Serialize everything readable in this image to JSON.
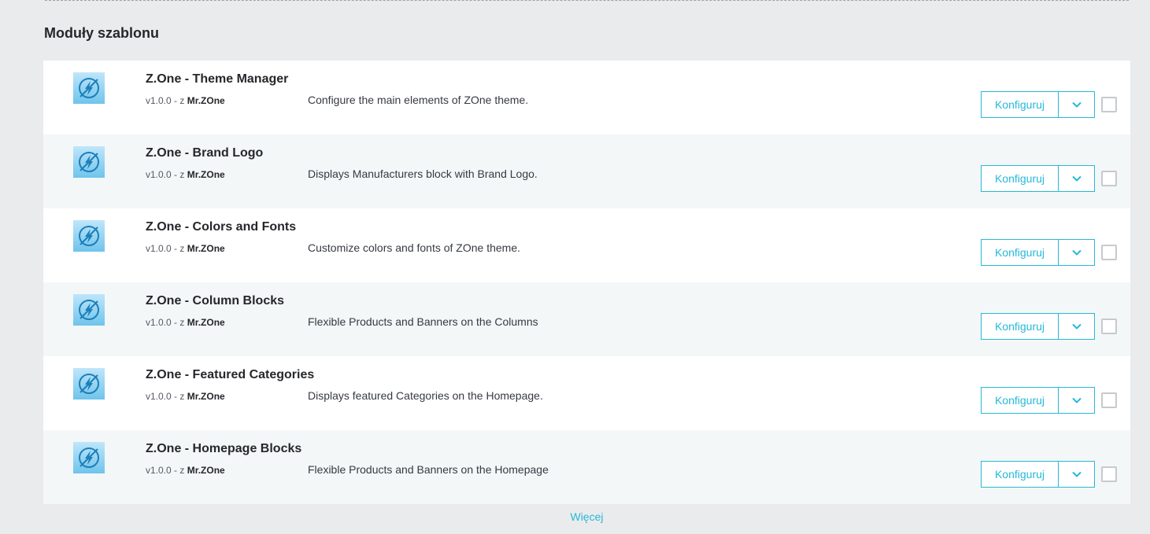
{
  "section": {
    "title": "Moduły szablonu"
  },
  "modules": [
    {
      "name": "Z.One - Theme Manager",
      "version": "v1.0.0 - z",
      "author": "Mr.ZOne",
      "description": "Configure the main elements of ZOne theme.",
      "configure_label": "Konfiguruj"
    },
    {
      "name": "Z.One - Brand Logo",
      "version": "v1.0.0 - z",
      "author": "Mr.ZOne",
      "description": "Displays Manufacturers block with Brand Logo.",
      "configure_label": "Konfiguruj"
    },
    {
      "name": "Z.One - Colors and Fonts",
      "version": "v1.0.0 - z",
      "author": "Mr.ZOne",
      "description": "Customize colors and fonts of ZOne theme.",
      "configure_label": "Konfiguruj"
    },
    {
      "name": "Z.One - Column Blocks",
      "version": "v1.0.0 - z",
      "author": "Mr.ZOne",
      "description": "Flexible Products and Banners on the Columns",
      "configure_label": "Konfiguruj"
    },
    {
      "name": "Z.One - Featured Categories",
      "version": "v1.0.0 - z",
      "author": "Mr.ZOne",
      "description": "Displays featured Categories on the Homepage.",
      "configure_label": "Konfiguruj"
    },
    {
      "name": "Z.One - Homepage Blocks",
      "version": "v1.0.0 - z",
      "author": "Mr.ZOne",
      "description": "Flexible Products and Banners on the Homepage",
      "configure_label": "Konfiguruj"
    }
  ],
  "footer": {
    "more_label": "Więcej"
  },
  "icons": {
    "module": "zone-lightning-icon",
    "dropdown": "chevron-down-icon"
  },
  "colors": {
    "accent": "#25b9d7",
    "background": "#eaebec",
    "row_alt": "#f4f7f8"
  }
}
